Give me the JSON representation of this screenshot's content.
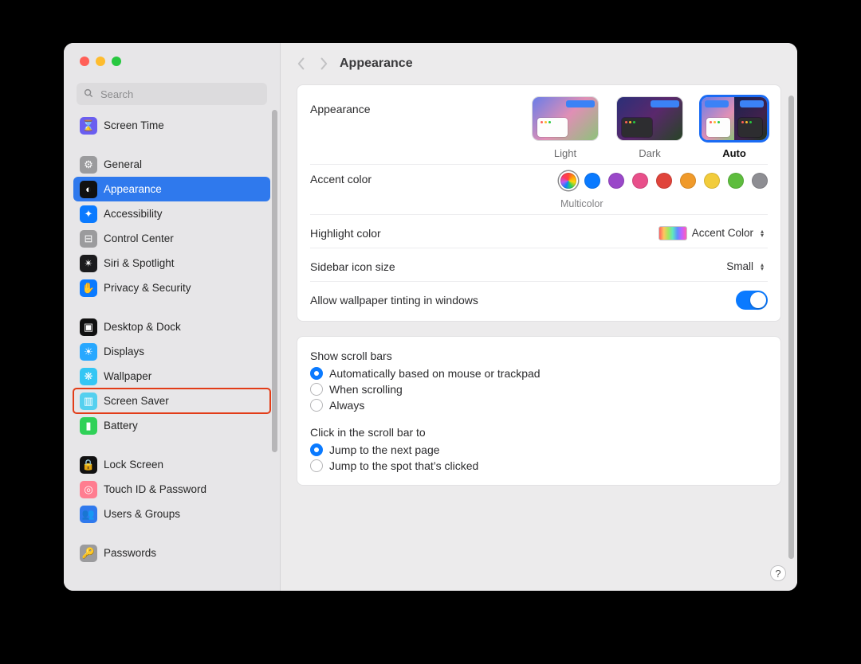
{
  "window_title": "Appearance",
  "search": {
    "placeholder": "Search"
  },
  "sidebar": {
    "groups": [
      {
        "items": [
          {
            "id": "screen-time",
            "label": "Screen Time",
            "icon_bg": "#6a5ef0",
            "glyph": "⌛"
          }
        ]
      },
      {
        "items": [
          {
            "id": "general",
            "label": "General",
            "icon_bg": "#9b9b9d",
            "glyph": "⚙"
          },
          {
            "id": "appearance",
            "label": "Appearance",
            "icon_bg": "#111111",
            "glyph": "◐",
            "selected": true
          },
          {
            "id": "accessibility",
            "label": "Accessibility",
            "icon_bg": "#0a7aff",
            "glyph": "✦"
          },
          {
            "id": "control-center",
            "label": "Control Center",
            "icon_bg": "#9b9b9d",
            "glyph": "⊟"
          },
          {
            "id": "siri-spotlight",
            "label": "Siri & Spotlight",
            "icon_bg": "#1b1b1d",
            "glyph": "✴"
          },
          {
            "id": "privacy-security",
            "label": "Privacy & Security",
            "icon_bg": "#0a7aff",
            "glyph": "✋"
          }
        ]
      },
      {
        "items": [
          {
            "id": "desktop-dock",
            "label": "Desktop & Dock",
            "icon_bg": "#111111",
            "glyph": "▣"
          },
          {
            "id": "displays",
            "label": "Displays",
            "icon_bg": "#28a8ff",
            "glyph": "☀"
          },
          {
            "id": "wallpaper",
            "label": "Wallpaper",
            "icon_bg": "#34c6f4",
            "glyph": "❋"
          },
          {
            "id": "screen-saver",
            "label": "Screen Saver",
            "icon_bg": "#55d0ef",
            "glyph": "▥",
            "boxed": true
          },
          {
            "id": "battery",
            "label": "Battery",
            "icon_bg": "#30d158",
            "glyph": "▮"
          }
        ]
      },
      {
        "items": [
          {
            "id": "lock-screen",
            "label": "Lock Screen",
            "icon_bg": "#111111",
            "glyph": "🔒"
          },
          {
            "id": "touch-id",
            "label": "Touch ID & Password",
            "icon_bg": "#ff7d90",
            "glyph": "◎"
          },
          {
            "id": "users-groups",
            "label": "Users & Groups",
            "icon_bg": "#2f79ed",
            "glyph": "👥"
          }
        ]
      },
      {
        "items": [
          {
            "id": "passwords",
            "label": "Passwords",
            "icon_bg": "#9b9b9d",
            "glyph": "🔑"
          }
        ]
      }
    ]
  },
  "appearance_section": {
    "label": "Appearance",
    "options": [
      {
        "id": "light",
        "label": "Light"
      },
      {
        "id": "dark",
        "label": "Dark"
      },
      {
        "id": "auto",
        "label": "Auto",
        "selected": true
      }
    ]
  },
  "accent": {
    "label": "Accent color",
    "caption": "Multicolor",
    "colors": [
      {
        "name": "multicolor",
        "css": "conic-gradient(#ff453a,#ff9f0a,#ffd60a,#30d158,#0a84ff,#bf5af2,#ff375f,#ff453a)",
        "selected": true
      },
      {
        "name": "blue",
        "css": "#0a7aff"
      },
      {
        "name": "purple",
        "css": "#9a48c9"
      },
      {
        "name": "pink",
        "css": "#e84f8a"
      },
      {
        "name": "red",
        "css": "#e0443b"
      },
      {
        "name": "orange",
        "css": "#f09a2a"
      },
      {
        "name": "yellow",
        "css": "#f2cc3b"
      },
      {
        "name": "green",
        "css": "#5ebd3e"
      },
      {
        "name": "graphite",
        "css": "#8e8e93"
      }
    ]
  },
  "highlight": {
    "label": "Highlight color",
    "value": "Accent Color"
  },
  "sidebar_size": {
    "label": "Sidebar icon size",
    "value": "Small"
  },
  "tinting": {
    "label": "Allow wallpaper tinting in windows",
    "on": true
  },
  "scrollbars": {
    "title": "Show scroll bars",
    "options": [
      {
        "label": "Automatically based on mouse or trackpad",
        "checked": true
      },
      {
        "label": "When scrolling"
      },
      {
        "label": "Always"
      }
    ]
  },
  "scrollclick": {
    "title": "Click in the scroll bar to",
    "options": [
      {
        "label": "Jump to the next page",
        "checked": true
      },
      {
        "label": "Jump to the spot that’s clicked"
      }
    ]
  }
}
